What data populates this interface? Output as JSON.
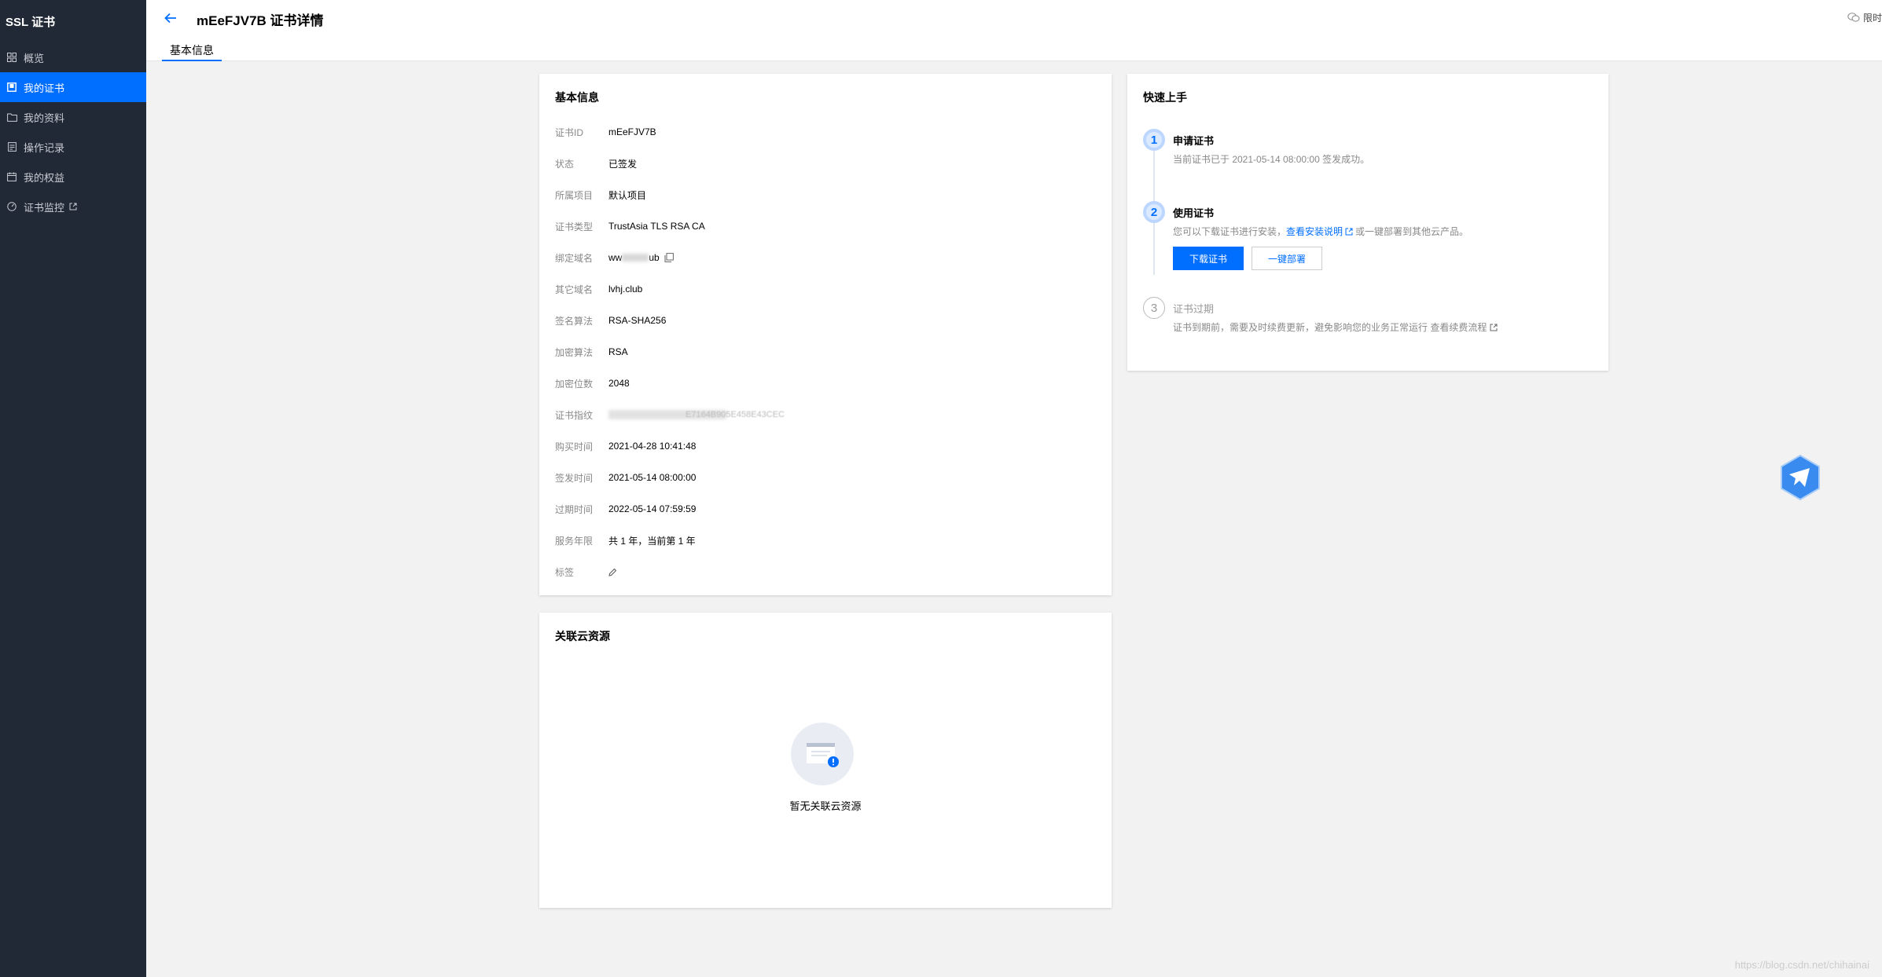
{
  "sidebar": {
    "brand": "SSL 证书",
    "items": [
      {
        "label": "概览",
        "icon": "grid-icon"
      },
      {
        "label": "我的证书",
        "icon": "certificate-icon",
        "active": true
      },
      {
        "label": "我的资料",
        "icon": "folder-icon"
      },
      {
        "label": "操作记录",
        "icon": "document-icon"
      },
      {
        "label": "我的权益",
        "icon": "calendar-icon"
      },
      {
        "label": "证书监控",
        "icon": "monitor-icon",
        "external": true
      }
    ]
  },
  "header": {
    "title": "mEeFJV7B 证书详情",
    "right_text": "限时",
    "tab": "基本信息"
  },
  "basic_info": {
    "title": "基本信息",
    "rows": [
      {
        "label": "证书ID",
        "value": "mEeFJV7B"
      },
      {
        "label": "状态",
        "value": "已签发"
      },
      {
        "label": "所属项目",
        "value": "默认项目"
      },
      {
        "label": "证书类型",
        "value": "TrustAsia TLS RSA CA"
      },
      {
        "label": "绑定域名",
        "value_prefix": "ww",
        "value_suffix": "ub"
      },
      {
        "label": "其它域名",
        "value": "lvhj.club"
      },
      {
        "label": "签名算法",
        "value": "RSA-SHA256"
      },
      {
        "label": "加密算法",
        "value": "RSA"
      },
      {
        "label": "加密位数",
        "value": "2048"
      },
      {
        "label": "证书指纹",
        "value": "E7164B905E458E43CEC"
      },
      {
        "label": "购买时间",
        "value": "2021-04-28 10:41:48"
      },
      {
        "label": "签发时间",
        "value": "2021-05-14 08:00:00"
      },
      {
        "label": "过期时间",
        "value": "2022-05-14 07:59:59"
      },
      {
        "label": "服务年限",
        "value": "共 1 年，当前第 1 年"
      },
      {
        "label": "标签",
        "value": ""
      }
    ]
  },
  "quick_start": {
    "title": "快速上手",
    "steps": [
      {
        "num": "1",
        "title": "申请证书",
        "desc": "当前证书已于 2021-05-14 08:00:00 签发成功。"
      },
      {
        "num": "2",
        "title": "使用证书",
        "desc_prefix": "您可以下载证书进行安装，",
        "link": "查看安装说明",
        "desc_suffix": "或一键部署到其他云产品。"
      },
      {
        "num": "3",
        "title": "证书过期",
        "desc": "证书到期前，需要及时续费更新，避免影响您的业务正常运行 查看续费流程"
      }
    ],
    "download_button": "下载证书",
    "deploy_button": "一键部署"
  },
  "related": {
    "title": "关联云资源",
    "empty_text": "暂无关联云资源"
  },
  "watermark": "https://blog.csdn.net/chihainai",
  "colors": {
    "accent": "#006eff",
    "sidebar_bg": "#212836"
  }
}
